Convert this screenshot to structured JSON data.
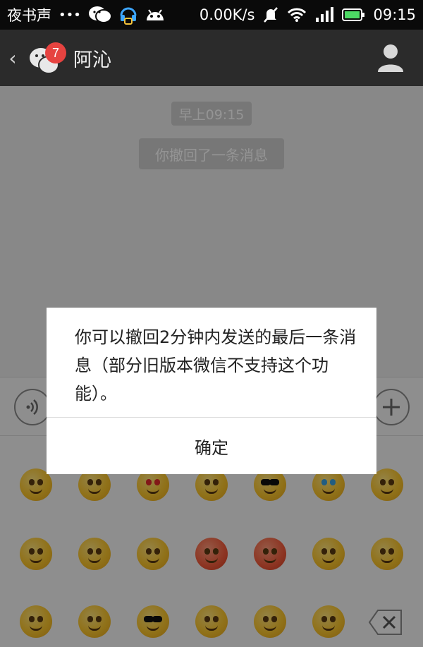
{
  "status_bar": {
    "carrier": "夜书声",
    "dots": "•••",
    "speed": "0.00K/s",
    "time": "09:15"
  },
  "header": {
    "back_glyph": "‹",
    "unread_count": "7",
    "title": "阿沁"
  },
  "chat": {
    "timestamp": "早上09:15",
    "system_message": "你撤回了一条消息"
  },
  "dialog": {
    "message": "你可以撤回2分钟内发送的最后一条消息（部分旧版本微信不支持这个功能）。",
    "ok_label": "确定"
  },
  "colors": {
    "status_bar_bg": "#0a0a0a",
    "header_bg": "#2b2b2b",
    "badge_red": "#e64340",
    "chat_bg": "#ebebeb"
  },
  "icons": {
    "status": [
      "wechat-icon",
      "headset-icon",
      "android-icon",
      "mute-icon",
      "wifi-icon",
      "signal-icon",
      "battery-icon"
    ],
    "header": [
      "back-icon",
      "chat-bubbles-icon",
      "profile-icon"
    ],
    "input": [
      "voice-icon",
      "plus-icon",
      "delete-icon"
    ]
  }
}
